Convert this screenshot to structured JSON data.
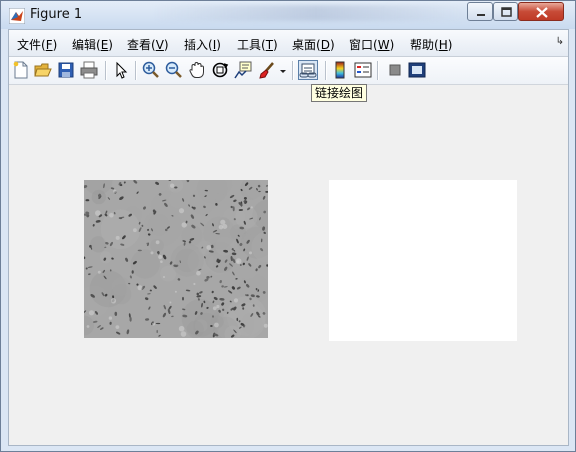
{
  "window": {
    "title": "Figure 1"
  },
  "menubar": {
    "items": [
      {
        "label": "文件(",
        "key": "F",
        "suffix": ")"
      },
      {
        "label": "编辑(",
        "key": "E",
        "suffix": ")"
      },
      {
        "label": "查看(",
        "key": "V",
        "suffix": ")"
      },
      {
        "label": "插入(",
        "key": "I",
        "suffix": ")"
      },
      {
        "label": "工具(",
        "key": "T",
        "suffix": ")"
      },
      {
        "label": "桌面(",
        "key": "D",
        "suffix": ")"
      },
      {
        "label": "窗口(",
        "key": "W",
        "suffix": ")"
      },
      {
        "label": "帮助(",
        "key": "H",
        "suffix": ")"
      }
    ]
  },
  "toolbar": {
    "icons": [
      "new-figure-icon",
      "open-file-icon",
      "save-icon",
      "print-icon",
      "pointer-icon",
      "zoom-in-icon",
      "zoom-out-icon",
      "pan-hand-icon",
      "rotate-3d-icon",
      "data-cursor-icon",
      "brush-icon",
      "brush-dropdown-icon",
      "link-plot-icon",
      "colorbar-icon",
      "legend-icon",
      "hide-plot-tools-icon",
      "show-plot-tools-icon"
    ]
  },
  "tooltip": {
    "text": "链接绘图"
  },
  "colors": {
    "title_bar": "#d4e2f2",
    "close_button": "#c74b37",
    "figure_bg": "#f0f0f0",
    "image_gray": "#a7a7a7"
  }
}
